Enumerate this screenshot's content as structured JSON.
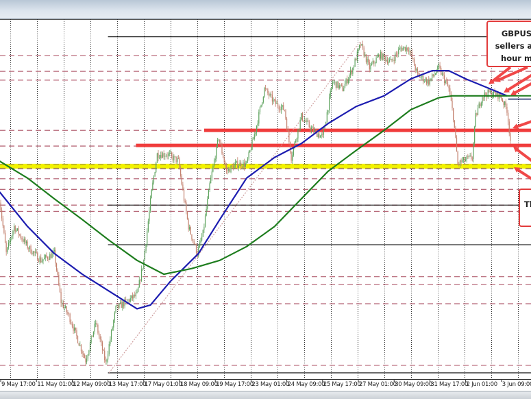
{
  "chart_data": {
    "type": "candlestick",
    "timeframe_hint": "hourly",
    "x_tick_labels": [
      "9 May 17:00",
      "11 May 01:00",
      "12 May 09:00",
      "13 May 17:00",
      "17 May 01:00",
      "18 May 09:00",
      "19 May 17:00",
      "23 May 01:00",
      "24 May 09:00",
      "25 May 17:00",
      "27 May 01:00",
      "30 May 09:00",
      "31 May 17:00",
      "2 Jun 01:00",
      "3 Jun 09:00"
    ],
    "ylim": [
      1.213,
      1.2703
    ],
    "grid": true,
    "price_path": [
      {
        "t": "9 May 16:00",
        "p": 1.2417
      },
      {
        "t": "9 May 22:00",
        "p": 1.233
      },
      {
        "t": "10 May 05:00",
        "p": 1.2373
      },
      {
        "t": "10 May 17:00",
        "p": 1.2341
      },
      {
        "t": "11 May 05:00",
        "p": 1.2319
      },
      {
        "t": "11 May 17:00",
        "p": 1.233
      },
      {
        "t": "11 May 23:00",
        "p": 1.2253
      },
      {
        "t": "12 May 06:00",
        "p": 1.2231
      },
      {
        "t": "12 May 15:00",
        "p": 1.2188
      },
      {
        "t": "12 May 21:00",
        "p": 1.216
      },
      {
        "t": "13 May 06:00",
        "p": 1.222
      },
      {
        "t": "13 May 15:00",
        "p": 1.2155
      },
      {
        "t": "16 May 00:00",
        "p": 1.2242
      },
      {
        "t": "16 May 09:00",
        "p": 1.2253
      },
      {
        "t": "16 May 19:00",
        "p": 1.2264
      },
      {
        "t": "17 May 01:00",
        "p": 1.2319
      },
      {
        "t": "17 May 08:00",
        "p": 1.2428
      },
      {
        "t": "17 May 13:00",
        "p": 1.2488
      },
      {
        "t": "17 May 22:00",
        "p": 1.2488
      },
      {
        "t": "18 May 08:00",
        "p": 1.2477
      },
      {
        "t": "18 May 13:00",
        "p": 1.2417
      },
      {
        "t": "18 May 17:00",
        "p": 1.2373
      },
      {
        "t": "19 May 01:00",
        "p": 1.233
      },
      {
        "t": "19 May 06:00",
        "p": 1.2362
      },
      {
        "t": "19 May 12:00",
        "p": 1.2439
      },
      {
        "t": "19 May 20:00",
        "p": 1.2515
      },
      {
        "t": "20 May 03:00",
        "p": 1.2461
      },
      {
        "t": "20 May 12:00",
        "p": 1.2472
      },
      {
        "t": "20 May 21:00",
        "p": 1.2472
      },
      {
        "t": "23 May 05:00",
        "p": 1.2526
      },
      {
        "t": "23 May 13:00",
        "p": 1.2592
      },
      {
        "t": "23 May 22:00",
        "p": 1.257
      },
      {
        "t": "24 May 07:00",
        "p": 1.2559
      },
      {
        "t": "24 May 13:00",
        "p": 1.2483
      },
      {
        "t": "24 May 22:00",
        "p": 1.2548
      },
      {
        "t": "25 May 08:00",
        "p": 1.2526
      },
      {
        "t": "25 May 17:00",
        "p": 1.2515
      },
      {
        "t": "26 May 02:00",
        "p": 1.2603
      },
      {
        "t": "26 May 11:00",
        "p": 1.2592
      },
      {
        "t": "26 May 20:00",
        "p": 1.2625
      },
      {
        "t": "27 May 03:00",
        "p": 1.2663
      },
      {
        "t": "27 May 11:00",
        "p": 1.2625
      },
      {
        "t": "27 May 20:00",
        "p": 1.2646
      },
      {
        "t": "30 May 06:00",
        "p": 1.2635
      },
      {
        "t": "30 May 15:00",
        "p": 1.2657
      },
      {
        "t": "30 May 22:00",
        "p": 1.2657
      },
      {
        "t": "31 May 06:00",
        "p": 1.2614
      },
      {
        "t": "31 May 16:00",
        "p": 1.2603
      },
      {
        "t": "1 Jun 01:00",
        "p": 1.2625
      },
      {
        "t": "1 Jun 10:00",
        "p": 1.2592
      },
      {
        "t": "1 Jun 14:00",
        "p": 1.2548
      },
      {
        "t": "1 Jun 18:00",
        "p": 1.2472
      },
      {
        "t": "1 Jun 22:00",
        "p": 1.2477
      },
      {
        "t": "2 Jun 07:00",
        "p": 1.2483
      },
      {
        "t": "2 Jun 10:00",
        "p": 1.2548
      },
      {
        "t": "2 Jun 16:00",
        "p": 1.2581
      },
      {
        "t": "2 Jun 22:00",
        "p": 1.2586
      },
      {
        "t": "3 Jun 08:00",
        "p": 1.2581
      },
      {
        "t": "3 Jun 14:00",
        "p": 1.2559
      },
      {
        "t": "3 Jun 17:00",
        "p": 1.251
      }
    ],
    "moving_averages": [
      {
        "color": "#1c1cb0",
        "points": [
          {
            "t": "9 May 16:00",
            "p": 1.2428
          },
          {
            "t": "10 May 17:00",
            "p": 1.2373
          },
          {
            "t": "11 May 17:00",
            "p": 1.233
          },
          {
            "t": "12 May 18:00",
            "p": 1.2297
          },
          {
            "t": "13 May 18:00",
            "p": 1.227
          },
          {
            "t": "16 May 19:00",
            "p": 1.2242
          },
          {
            "t": "17 May 07:00",
            "p": 1.2248
          },
          {
            "t": "18 May 01:00",
            "p": 1.2286
          },
          {
            "t": "19 May 02:00",
            "p": 1.233
          },
          {
            "t": "19 May 21:00",
            "p": 1.2384
          },
          {
            "t": "20 May 21:00",
            "p": 1.245
          },
          {
            "t": "23 May 22:00",
            "p": 1.2483
          },
          {
            "t": "24 May 22:00",
            "p": 1.2505
          },
          {
            "t": "25 May 22:00",
            "p": 1.2537
          },
          {
            "t": "26 May 23:00",
            "p": 1.2564
          },
          {
            "t": "30 May 00:00",
            "p": 1.2581
          },
          {
            "t": "31 May 00:00",
            "p": 1.2608
          },
          {
            "t": "31 May 19:00",
            "p": 1.2621
          },
          {
            "t": "1 Jun 10:00",
            "p": 1.2621
          },
          {
            "t": "2 Jun 01:00",
            "p": 1.2608
          },
          {
            "t": "2 Jun 19:00",
            "p": 1.2595
          },
          {
            "t": "3 Jun 14:00",
            "p": 1.2581
          }
        ]
      },
      {
        "color": "#1e7d1e",
        "points": [
          {
            "t": "9 May 16:00",
            "p": 1.2477
          },
          {
            "t": "10 May 17:00",
            "p": 1.245
          },
          {
            "t": "11 May 17:00",
            "p": 1.2417
          },
          {
            "t": "12 May 18:00",
            "p": 1.2384
          },
          {
            "t": "13 May 18:00",
            "p": 1.2351
          },
          {
            "t": "16 May 19:00",
            "p": 1.2319
          },
          {
            "t": "17 May 19:00",
            "p": 1.2297
          },
          {
            "t": "18 May 20:00",
            "p": 1.2306
          },
          {
            "t": "19 May 21:00",
            "p": 1.2319
          },
          {
            "t": "20 May 21:00",
            "p": 1.2341
          },
          {
            "t": "23 May 22:00",
            "p": 1.2373
          },
          {
            "t": "24 May 22:00",
            "p": 1.2417
          },
          {
            "t": "25 May 22:00",
            "p": 1.2461
          },
          {
            "t": "26 May 23:00",
            "p": 1.2494
          },
          {
            "t": "30 May 00:00",
            "p": 1.2526
          },
          {
            "t": "31 May 00:00",
            "p": 1.2559
          },
          {
            "t": "1 Jun 01:00",
            "p": 1.2578
          },
          {
            "t": "1 Jun 13:00",
            "p": 1.2581
          },
          {
            "t": "2 Jun 13:00",
            "p": 1.2581
          },
          {
            "t": "3 Jun 17:00",
            "p": 1.2581
          }
        ]
      }
    ],
    "horizontal_levels": {
      "dashed": [
        1.2645,
        1.262,
        1.2606,
        1.2526,
        1.2501,
        1.2472,
        1.2465,
        1.2449,
        1.2432,
        1.2407,
        1.2397,
        1.2293,
        1.2281,
        1.225,
        1.2152
      ],
      "solid": [
        {
          "p": 1.2675,
          "from": "13 May 17:00"
        },
        {
          "p": 1.2407,
          "from": "13 May 17:00"
        },
        {
          "p": 1.2344,
          "from": "13 May 17:00"
        },
        {
          "p": 1.214,
          "from": "13 May 17:00"
        }
      ],
      "red": [
        {
          "p": 1.2526,
          "from": "19 May 07:00"
        },
        {
          "p": 1.2502,
          "from": "16 May 18:00"
        }
      ],
      "yellow": [
        1.2469
      ],
      "navy": [
        {
          "p": 1.2578,
          "from": "3 Jun 15:00"
        }
      ]
    },
    "trendline": {
      "from": {
        "t": "13 May 18:00",
        "p": 1.214
      },
      "to": {
        "t": "27 May 02:00",
        "p": 1.2666
      }
    },
    "colors": {
      "up": "#5fa35f",
      "down": "#c27f6c",
      "red_level": "#f03c3c",
      "yellow_level": "#f2f200",
      "dashed_level": "#b86a7a",
      "grid": "#333333"
    }
  },
  "annotations": [
    {
      "lines": [
        "GBPUS",
        "sellers ag",
        "hour m"
      ]
    },
    {
      "lines": [
        "Th"
      ]
    }
  ]
}
